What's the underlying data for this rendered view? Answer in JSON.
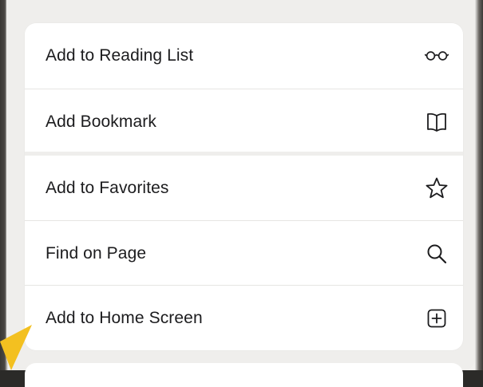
{
  "menu": {
    "items": [
      {
        "label": "Add to Reading List",
        "icon": "glasses-icon"
      },
      {
        "label": "Add Bookmark",
        "icon": "book-icon"
      },
      {
        "label": "Add to Favorites",
        "icon": "star-icon"
      },
      {
        "label": "Find on Page",
        "icon": "search-icon"
      },
      {
        "label": "Add to Home Screen",
        "icon": "add-square-icon"
      }
    ]
  },
  "colors": {
    "text": "#1c1c1e",
    "card": "#ffffff",
    "background": "#efeeec",
    "pointer": "#f3c020"
  }
}
